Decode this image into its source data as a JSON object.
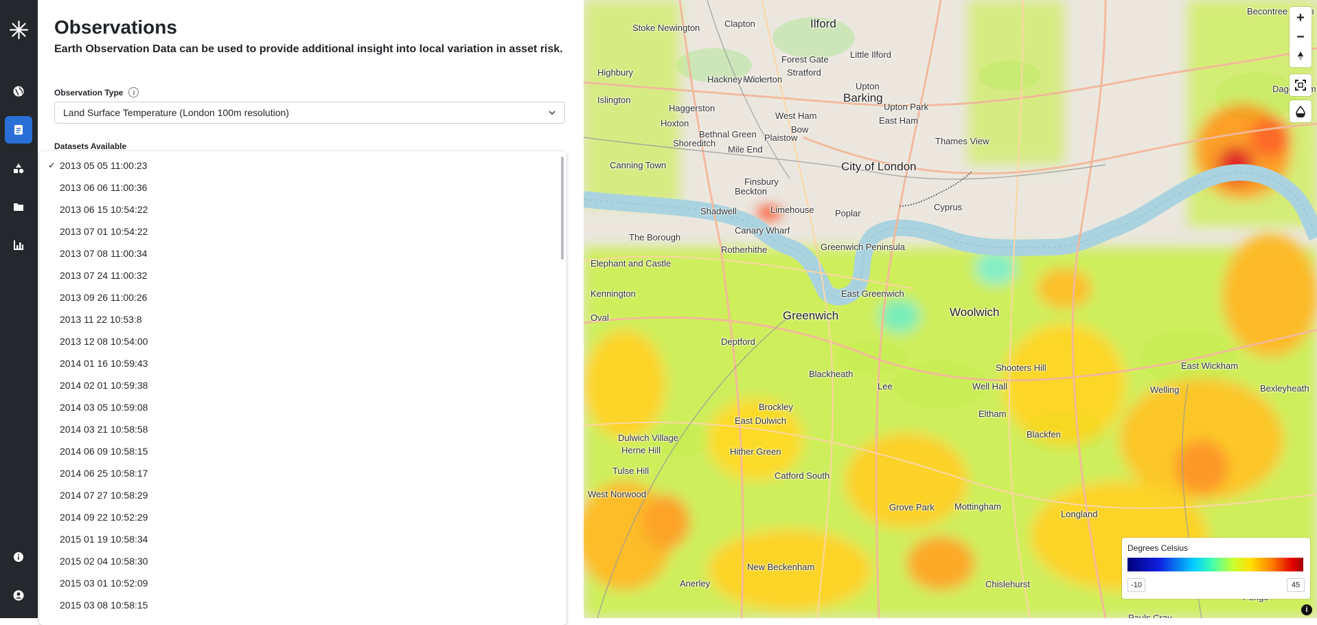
{
  "sidebar": {
    "items": [
      {
        "icon": "globe-icon"
      },
      {
        "icon": "observations-icon",
        "active": true
      },
      {
        "icon": "shapes-icon"
      },
      {
        "icon": "folder-icon"
      },
      {
        "icon": "bar-chart-icon"
      },
      {
        "icon": "info-icon"
      },
      {
        "icon": "user-icon"
      }
    ]
  },
  "panel": {
    "title": "Observations",
    "subtitle": "Earth Observation Data can be used to provide additional insight into local variation in asset risk.",
    "observation_type_label": "Observation Type",
    "observation_type_value": "Land Surface Temperature (London 100m resolution)",
    "datasets_label": "Datasets Available",
    "datasets": [
      {
        "label": "2013 05 05 11:00:23",
        "selected": true
      },
      {
        "label": "2013 06 06 11:00:36"
      },
      {
        "label": "2013 06 15 10:54:22"
      },
      {
        "label": "2013 07 01 10:54:22"
      },
      {
        "label": "2013 07 08 11:00:34"
      },
      {
        "label": "2013 07 24 11:00:32"
      },
      {
        "label": "2013 09 26 11:00:26"
      },
      {
        "label": "2013 11 22 10:53:8"
      },
      {
        "label": "2013 12 08 10:54:00"
      },
      {
        "label": "2014 01 16 10:59:43"
      },
      {
        "label": "2014 02 01 10:59:38"
      },
      {
        "label": "2014 03 05 10:59:08"
      },
      {
        "label": "2014 03 21 10:58:58"
      },
      {
        "label": "2014 06 09 10:58:15"
      },
      {
        "label": "2014 06 25 10:58:17"
      },
      {
        "label": "2014 07 27 10:58:29"
      },
      {
        "label": "2014 09 22 10:52:29"
      },
      {
        "label": "2015 01 19 10:58:34"
      },
      {
        "label": "2015 02 04 10:58:30"
      },
      {
        "label": "2015 03 01 10:52:09"
      },
      {
        "label": "2015 03 08 10:58:15"
      }
    ],
    "check_glyph": "✓"
  },
  "map": {
    "controls": {
      "zoom_in": "+",
      "zoom_out": "−"
    },
    "labels": [
      "Becontree Heath",
      "Clapton",
      "Ilford",
      "Stoke Newington",
      "Forest Gate",
      "Little Ilford",
      "Homerton",
      "Highbury",
      "Hackney Wick",
      "Stratford",
      "Barking",
      "Dagenham",
      "Islington",
      "Haggerston",
      "Upton",
      "Upton Park",
      "West Ham",
      "Bethnal Green",
      "Hoxton",
      "Bow",
      "Plaistow",
      "East Ham",
      "Thames View",
      "Shoreditch",
      "Mile End",
      "Canning Town",
      "Finsbury",
      "City of London",
      "Beckton",
      "Shadwell",
      "Limehouse",
      "Poplar",
      "Cyprus",
      "Canary Wharf",
      "The Borough",
      "Rotherhithe",
      "Greenwich Peninsula",
      "Elephant and Castle",
      "Kennington",
      "East Greenwich",
      "Woolwich",
      "Greenwich",
      "Deptford",
      "Oval",
      "Shooters Hill",
      "East Wickham",
      "Blackheath",
      "Lee",
      "Well Hall",
      "Eltham",
      "Blackfen",
      "Brockley",
      "East Dulwich",
      "Dulwich Village",
      "Herne Hill",
      "Hither Green",
      "Catford South",
      "Tulse Hill",
      "West Norwood",
      "Grove Park",
      "Mottingham",
      "Longland",
      "New Beckenham",
      "Anerley",
      "Chislehurst",
      "Pauls Cray",
      "Bexleyheath",
      "Welling",
      "Penge"
    ],
    "legend": {
      "title": "Degrees Celsius",
      "min": "-10",
      "max": "45"
    },
    "attribution_glyph": "i"
  },
  "colors": {
    "sidebar_bg": "#24282d",
    "active": "#2a6fd6",
    "river": "#aad3df"
  }
}
